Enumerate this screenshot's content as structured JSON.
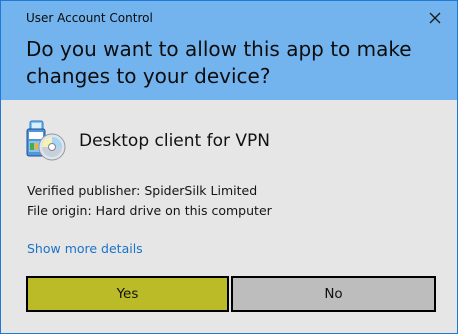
{
  "window": {
    "title": "User Account Control",
    "close_icon": "close-icon"
  },
  "header": {
    "question": "Do you want to allow this app to make changes to your device?",
    "background_color": "#74b4ee"
  },
  "app": {
    "icon": "app-disc-icon",
    "name": "Desktop client for VPN"
  },
  "details": {
    "publisher": "Verified publisher: SpiderSilk Limited",
    "origin": "File origin: Hard drive on this computer"
  },
  "links": {
    "show_more": "Show more details"
  },
  "buttons": {
    "yes_label": "Yes",
    "no_label": "No",
    "yes_color": "#bbbb27",
    "no_color": "#bdbdbd"
  }
}
